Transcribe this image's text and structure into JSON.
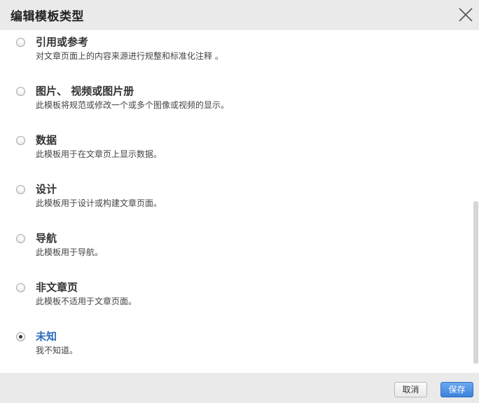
{
  "dialog": {
    "title": "编辑模板类型",
    "close_icon": "close-icon"
  },
  "options": [
    {
      "label": "引用或参考",
      "description": "对文章页面上的内容来源进行规整和标准化注释 。",
      "selected": false
    },
    {
      "label": "图片、 视频或图片册",
      "description": "此模板将规范或修改一个或多个图像或视频的显示。",
      "selected": false
    },
    {
      "label": "数据",
      "description": "此模板用于在文章页上显示数据。",
      "selected": false
    },
    {
      "label": "设计",
      "description": "此模板用于设计或构建文章页面。",
      "selected": false
    },
    {
      "label": "导航",
      "description": "此模板用于导航。",
      "selected": false
    },
    {
      "label": "非文章页",
      "description": "此模板不适用于文章页面。",
      "selected": false
    },
    {
      "label": "未知",
      "description": "我不知道。",
      "selected": true
    }
  ],
  "footer": {
    "cancel_label": "取消",
    "save_label": "保存"
  },
  "colors": {
    "header_bg": "#eaeaea",
    "selected_label": "#2a6bbf",
    "primary_button": "#3c82dc"
  }
}
